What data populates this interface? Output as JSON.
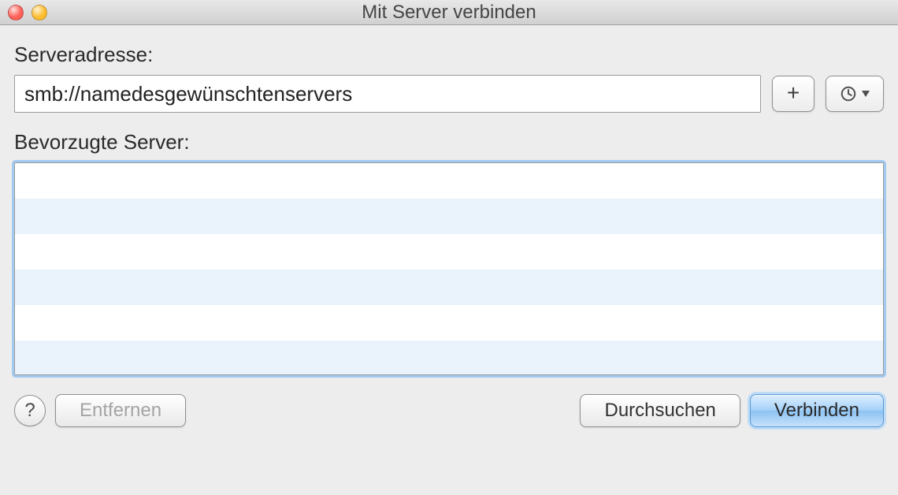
{
  "window": {
    "title": "Mit Server verbinden"
  },
  "labels": {
    "server_address": "Serveradresse:",
    "favorite_servers": "Bevorzugte Server:"
  },
  "fields": {
    "server_address_value": "smb://namedesgewünschtenservers"
  },
  "icons": {
    "plus": "plus-icon",
    "history": "clock-history-icon",
    "help": "?"
  },
  "buttons": {
    "remove": "Entfernen",
    "browse": "Durchsuchen",
    "connect": "Verbinden"
  },
  "traffic_lights": {
    "close": "#ff5f57",
    "minimize": "#ffbd2e"
  }
}
